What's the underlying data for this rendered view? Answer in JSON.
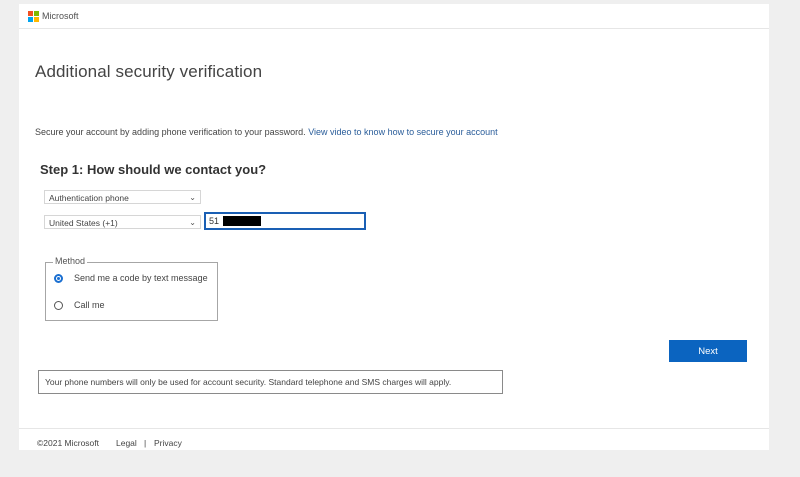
{
  "brand": {
    "name": "Microsoft",
    "logo_colors": [
      "#f25022",
      "#7fba00",
      "#00a4ef",
      "#ffb900"
    ]
  },
  "page": {
    "title": "Additional security verification",
    "intro_text": "Secure your account by adding phone verification to your password.",
    "intro_link": "View video to know how to secure your account"
  },
  "step1": {
    "title": "Step 1: How should we contact you?",
    "contact_method_select": "Authentication phone",
    "country_select": "United States (+1)",
    "phone_value": "51"
  },
  "method": {
    "legend": "Method",
    "options": [
      {
        "label": "Send me a code by text message",
        "selected": true
      },
      {
        "label": "Call me",
        "selected": false
      }
    ]
  },
  "actions": {
    "next_label": "Next",
    "accent_color": "#0b64c0"
  },
  "notice": "Your phone numbers will only be used for account security. Standard telephone and SMS charges will apply.",
  "footer": {
    "copyright": "©2021 Microsoft",
    "legal": "Legal",
    "separator": "|",
    "privacy": "Privacy"
  },
  "icons": {
    "select_chevron": "chevron-down-icon",
    "select_chevron_glyph": "⌄"
  }
}
